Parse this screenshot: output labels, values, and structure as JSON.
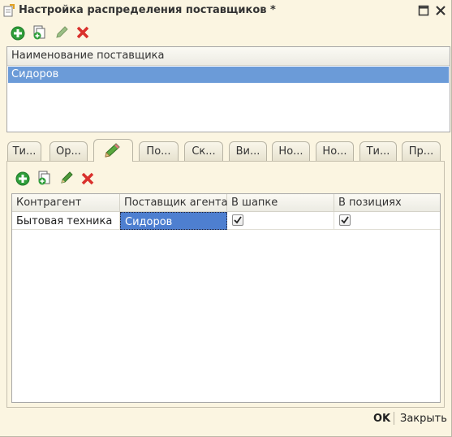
{
  "window": {
    "title": "Настройка распределения поставщиков *"
  },
  "suppliers_list": {
    "header": "Наименование поставщика",
    "rows": [
      "Сидоров"
    ]
  },
  "tabs": [
    "Ти...",
    "Ор...",
    "",
    "По...",
    "Ск...",
    "Ви...",
    "Но...",
    "Но...",
    "Ти...",
    "Пр..."
  ],
  "active_tab_icon": "pencil-icon",
  "grid": {
    "columns": [
      "Контрагент",
      "Поставщик агента",
      "В шапке",
      "В позициях"
    ],
    "rows": [
      {
        "kontragent": "Бытовая техника",
        "postavshchik": "Сидоров",
        "v_shapke": true,
        "v_pozitsiyakh": true
      }
    ]
  },
  "footer": {
    "ok_label": "OK",
    "close_label": "Закрыть"
  },
  "colors": {
    "selection": "#6b9bd8",
    "cell_selection": "#4e7fd0",
    "background": "#fbf5e1"
  }
}
